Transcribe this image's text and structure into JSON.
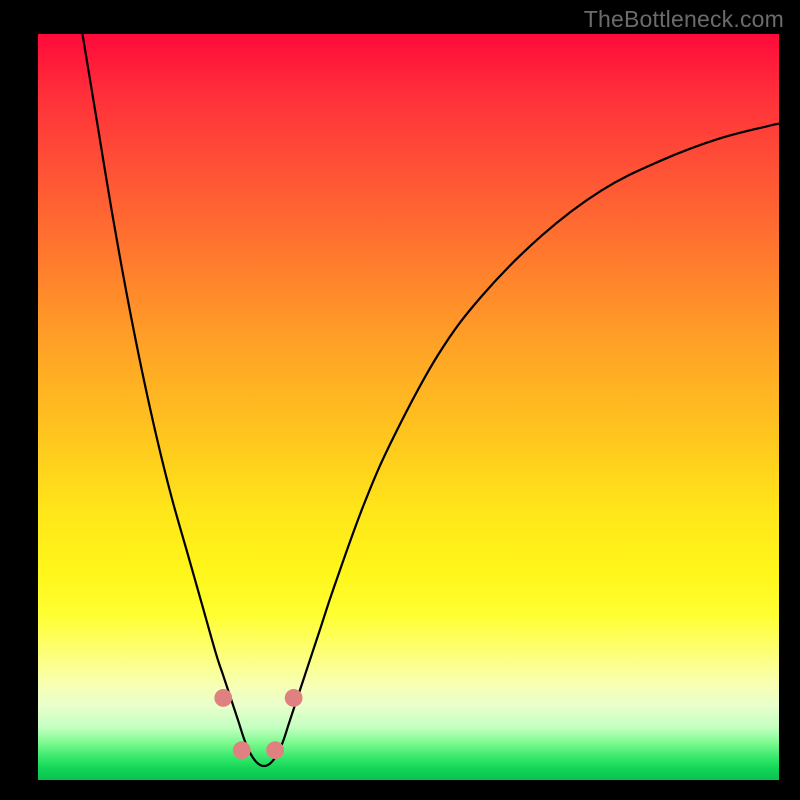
{
  "watermark": "TheBottleneck.com",
  "chart_data": {
    "type": "line",
    "title": "",
    "xlabel": "",
    "ylabel": "",
    "xlim": [
      0,
      100
    ],
    "ylim": [
      0,
      100
    ],
    "background_gradient": {
      "top": "#ff0a3a",
      "bottom": "#0bc24f",
      "stops": [
        "#ff0a3a",
        "#ff5136",
        "#ffa326",
        "#ffe61a",
        "#ffff33",
        "#c2ffc0",
        "#35e86b",
        "#0bc24f"
      ]
    },
    "series": [
      {
        "name": "curve",
        "color": "#000000",
        "x": [
          6,
          8,
          10,
          12,
          14,
          16,
          18,
          20,
          22,
          24,
          25,
          26,
          27,
          28,
          29,
          30,
          31,
          32,
          33,
          34,
          36,
          38,
          40,
          44,
          48,
          54,
          60,
          68,
          76,
          84,
          92,
          100
        ],
        "y": [
          100,
          88,
          76,
          65,
          55,
          46,
          38,
          31,
          24,
          17,
          14,
          11,
          8,
          5,
          3,
          2,
          2,
          3,
          5,
          8,
          14,
          20,
          26,
          37,
          46,
          57,
          65,
          73,
          79,
          83,
          86,
          88
        ]
      }
    ],
    "markers": [
      {
        "name": "left-upper-dot",
        "x": 25.0,
        "y": 11.0,
        "r": 1.2,
        "color": "#e08080"
      },
      {
        "name": "left-lower-dot",
        "x": 27.5,
        "y": 4.0,
        "r": 1.2,
        "color": "#e08080"
      },
      {
        "name": "right-lower-dot",
        "x": 32.0,
        "y": 4.0,
        "r": 1.2,
        "color": "#e08080"
      },
      {
        "name": "right-upper-dot",
        "x": 34.5,
        "y": 11.0,
        "r": 1.2,
        "color": "#e08080"
      }
    ]
  }
}
